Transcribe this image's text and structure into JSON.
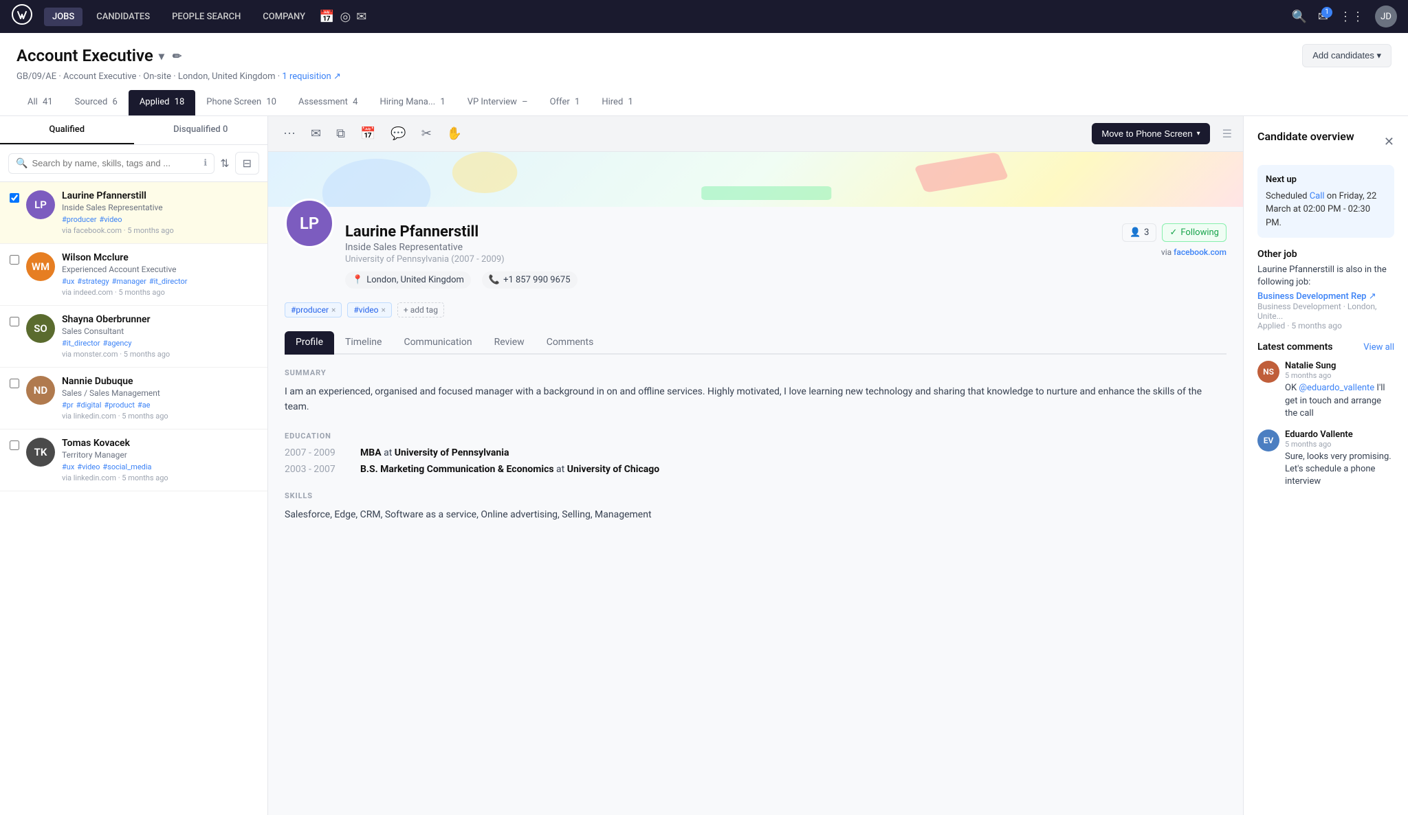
{
  "topnav": {
    "logo_text": "W",
    "items": [
      {
        "label": "JOBS",
        "active": true
      },
      {
        "label": "CANDIDATES",
        "active": false
      },
      {
        "label": "PEOPLE SEARCH",
        "active": false
      },
      {
        "label": "COMPANY",
        "active": false
      }
    ],
    "icon_calendar": "📅",
    "icon_target": "◎",
    "icon_inbox": "✉",
    "notification_count": "1",
    "icon_grid": "⋮⋮",
    "user_initials": "JD"
  },
  "page": {
    "title": "Account Executive",
    "meta": "GB/09/AE · Account Executive · On-site · London, United Kingdom · 1 requisition ↗",
    "add_candidates_label": "Add candidates ▾"
  },
  "stage_tabs": [
    {
      "label": "All",
      "count": "41",
      "active": false
    },
    {
      "label": "Sourced",
      "count": "6",
      "active": false
    },
    {
      "label": "Applied",
      "count": "18",
      "active": true
    },
    {
      "label": "Phone Screen",
      "count": "10",
      "active": false
    },
    {
      "label": "Assessment",
      "count": "4",
      "active": false
    },
    {
      "label": "Hiring Mana...",
      "count": "1",
      "active": false
    },
    {
      "label": "VP Interview",
      "count": "–",
      "active": false
    },
    {
      "label": "Offer",
      "count": "1",
      "active": false
    },
    {
      "label": "Hired",
      "count": "1",
      "active": false
    }
  ],
  "left_panel": {
    "sub_tabs": [
      {
        "label": "Qualified",
        "count": "",
        "active": true
      },
      {
        "label": "Disqualified",
        "count": "0",
        "active": false
      }
    ],
    "search_placeholder": "Search by name, skills, tags and ...",
    "candidates": [
      {
        "name": "Laurine Pfannerstill",
        "title": "Inside Sales Representative",
        "tags": [
          "#producer",
          "#video"
        ],
        "source": "via facebook.com",
        "time": "5 months ago",
        "avatar_color": "#7c5cbf",
        "initials": "LP",
        "selected": true
      },
      {
        "name": "Wilson Mcclure",
        "title": "Experienced Account Executive",
        "tags": [
          "#ux",
          "#strategy",
          "#manager",
          "#it_director"
        ],
        "source": "via indeed.com",
        "time": "5 months ago",
        "avatar_color": "#e67e22",
        "initials": "WM",
        "selected": false
      },
      {
        "name": "Shayna Oberbrunner",
        "title": "Sales Consultant",
        "tags": [
          "#it_director",
          "#agency"
        ],
        "source": "via monster.com",
        "time": "5 months ago",
        "avatar_color": "#5a6b2e",
        "initials": "SO",
        "selected": false
      },
      {
        "name": "Nannie Dubuque",
        "title": "Sales / Sales Management",
        "tags": [
          "#pr",
          "#digital",
          "#product",
          "#ae"
        ],
        "source": "via linkedin.com",
        "time": "5 months ago",
        "avatar_color": "#b07a4e",
        "initials": "ND",
        "selected": false
      },
      {
        "name": "Tomas Kovacek",
        "title": "Territory Manager",
        "tags": [
          "#ux",
          "#video",
          "#social_media"
        ],
        "source": "via linkedin.com",
        "time": "5 months ago",
        "avatar_color": "#4a4a4a",
        "initials": "TK",
        "selected": false
      }
    ]
  },
  "candidate_detail": {
    "name": "Laurine Pfannerstill",
    "role": "Inside Sales Representative",
    "education_brief": "University of Pennsylvania (2007 - 2009)",
    "location": "London, United Kingdom",
    "phone": "+1 857 990 9675",
    "followers_count": "3",
    "following_label": "Following",
    "source": "via facebook.com",
    "tags": [
      "#producer",
      "#video"
    ],
    "add_tag_label": "+ add tag",
    "tabs": [
      {
        "label": "Profile",
        "active": true
      },
      {
        "label": "Timeline",
        "active": false
      },
      {
        "label": "Communication",
        "active": false
      },
      {
        "label": "Review",
        "active": false
      },
      {
        "label": "Comments",
        "active": false
      }
    ],
    "summary_label": "SUMMARY",
    "summary_text": "I am an experienced, organised and focused manager with a background in on and offline services. Highly motivated, I love learning new technology and sharing that knowledge to nurture and enhance the skills of the team.",
    "education_label": "EDUCATION",
    "education": [
      {
        "years": "2007 - 2009",
        "degree": "MBA",
        "institution": "University of Pennsylvania"
      },
      {
        "years": "2003 - 2007",
        "degree": "B.S. Marketing Communication & Economics",
        "institution": "University of Chicago"
      }
    ],
    "skills_label": "SKILLS",
    "skills_text": "Salesforce, Edge, CRM, Software as a service, Online advertising, Selling, Management",
    "move_btn_label": "Move to Phone Screen",
    "action_icons": [
      "⋯",
      "✉",
      "⧉",
      "📅",
      "💬",
      "✂",
      "✋"
    ]
  },
  "right_panel": {
    "title": "Candidate overview",
    "next_up_label": "Next up",
    "next_up_text": "Scheduled",
    "next_up_link": "Call",
    "next_up_detail": "on Friday, 22 March at 02:00 PM - 02:30 PM.",
    "other_job_label": "Other job",
    "other_job_text": "Laurine Pfannerstill is also in the following job:",
    "other_job_link": "Business Development Rep ↗",
    "other_job_sub": "Business Development · London, Unite...",
    "other_job_meta": "Applied · 5 months ago",
    "comments_label": "Latest comments",
    "view_all_label": "View all",
    "comments": [
      {
        "author": "Natalie Sung",
        "time": "5 months ago",
        "text": "OK @eduardo_vallente I'll get in touch and arrange the call",
        "mention": "@eduardo_vallente",
        "avatar_color": "#c05e3a",
        "initials": "NS"
      },
      {
        "author": "Eduardo Vallente",
        "time": "5 months ago",
        "text": "Sure, looks very promising. Let's schedule a phone interview",
        "mention": "",
        "avatar_color": "#4b7ec1",
        "initials": "EV"
      }
    ]
  }
}
